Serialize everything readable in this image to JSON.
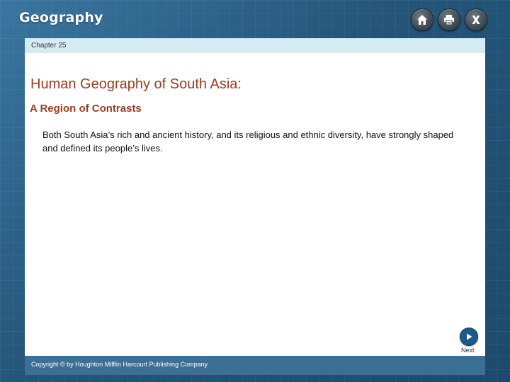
{
  "app": {
    "title": "Geography"
  },
  "toolbar": {
    "home_icon": "home-icon",
    "print_icon": "printer-icon",
    "close_icon": "close-icon"
  },
  "chapter": {
    "label": "Chapter 25"
  },
  "main": {
    "title": "Human Geography of South Asia:",
    "subtitle": "A Region of Contrasts",
    "body": "Both South Asia’s rich and ancient history, and its religious and ethnic diversity, have strongly shaped and defined its people’s lives."
  },
  "navigation": {
    "next_label": "Next",
    "next_icon": "play-arrow-icon"
  },
  "footer": {
    "copyright": "Copyright © by Houghton Mifflin Harcourt Publishing Company"
  },
  "colors": {
    "heading": "#9a3d1f",
    "chapter_bar": "#d6ecf5",
    "footer_bar": "#3c6f96",
    "next_button": "#1c5a8c"
  }
}
